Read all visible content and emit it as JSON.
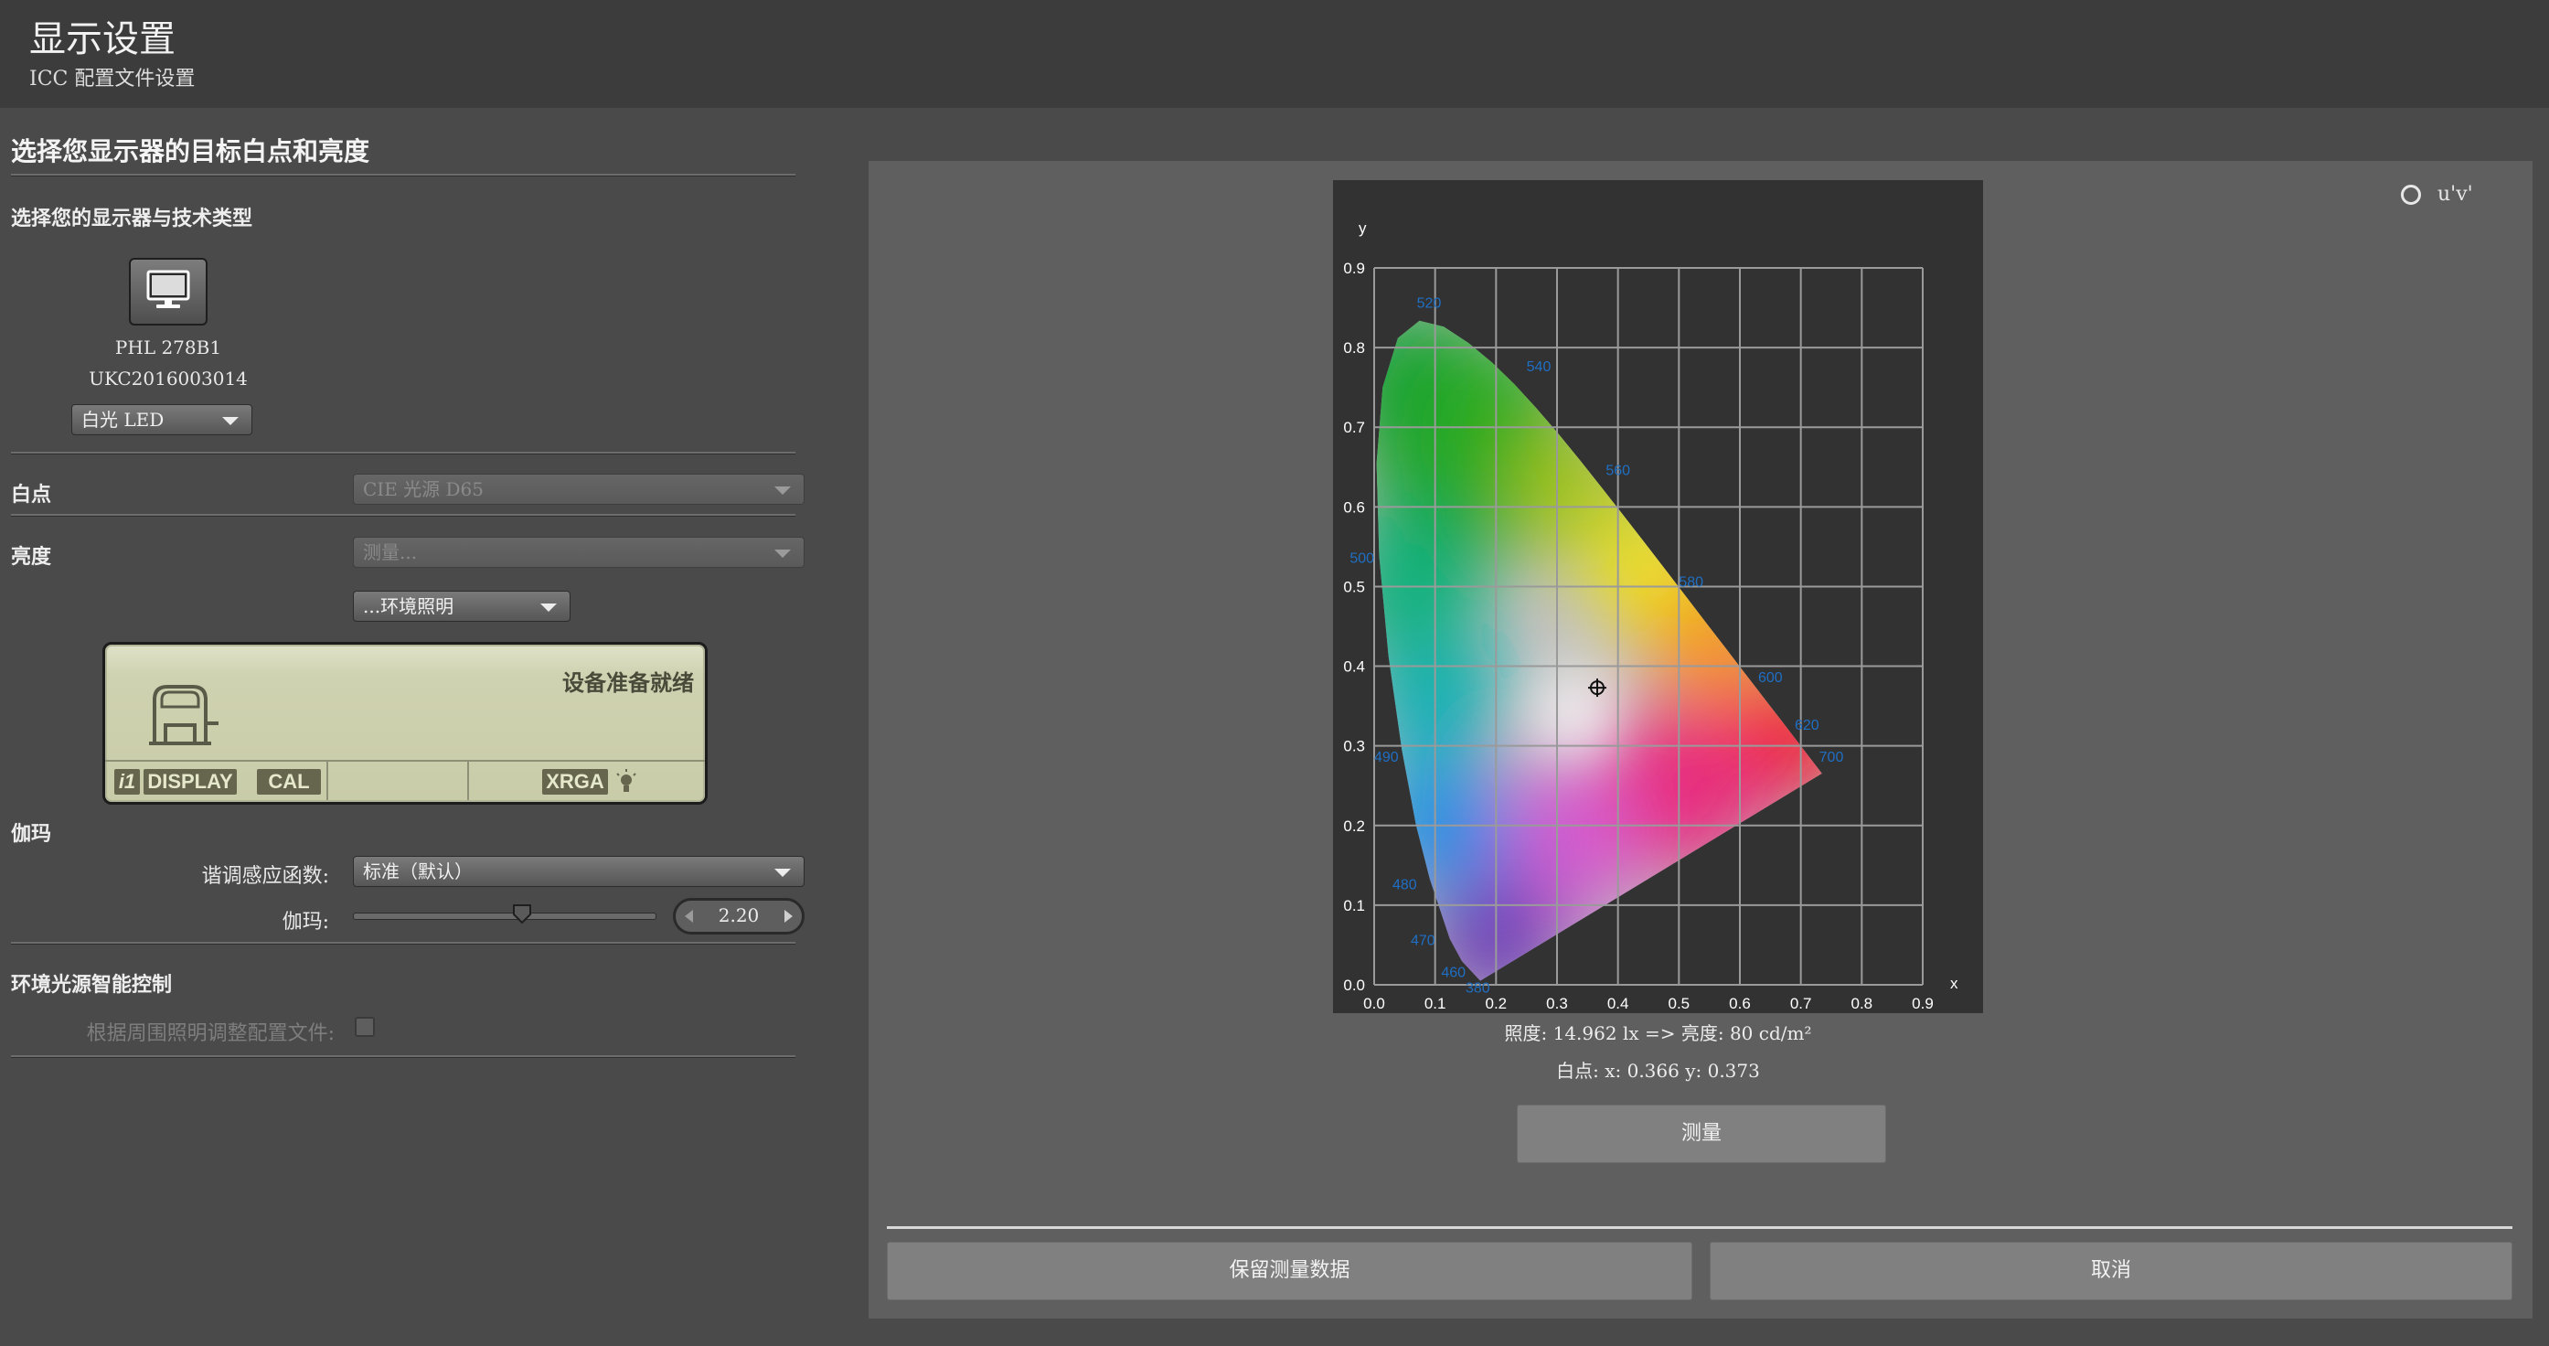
{
  "header": {
    "title": "显示设置",
    "subtitle": "ICC 配置文件设置"
  },
  "left": {
    "main_heading": "选择您显示器的目标白点和亮度",
    "display_section": {
      "heading": "选择您的显示器与技术类型",
      "monitor_name": "PHL 278B1",
      "monitor_serial": "UKC2016003014",
      "technology_value": "白光 LED"
    },
    "whitepoint": {
      "label": "白点",
      "value": "CIE 光源 D65"
    },
    "luminance": {
      "label": "亮度",
      "value": "测量...",
      "ambient_button": "...环境照明"
    },
    "device_panel": {
      "status": "设备准备就绪",
      "tags": {
        "i1": "i1",
        "display": "DISPLAY",
        "cal": "CAL",
        "xrga": "XRGA"
      }
    },
    "gamma": {
      "label": "伽玛",
      "trc_label": "谐调感应函数:",
      "trc_value": "标准（默认）",
      "gamma_label": "伽玛:",
      "gamma_value": "2.20",
      "gamma_fraction": 0.56
    },
    "ambient": {
      "heading": "环境光源智能控制",
      "checkbox_label": "根据周围照明调整配置文件:",
      "checked": false
    }
  },
  "right": {
    "uv_radio_label": "u'v'",
    "illuminance_text": "照度: 14.962 lx => 亮度: 80 cd/m²",
    "whitepoint_text": "白点:  x: 0.366  y: 0.373",
    "measure_button": "测量",
    "keep_button": "保留测量数据",
    "cancel_button": "取消"
  },
  "chart_data": {
    "type": "scatter",
    "title": "",
    "xlabel": "x",
    "ylabel": "y",
    "xlim": [
      0,
      0.9
    ],
    "ylim": [
      0,
      0.9
    ],
    "xticks": [
      "0.0",
      "0.1",
      "0.2",
      "0.3",
      "0.4",
      "0.5",
      "0.6",
      "0.7",
      "0.8",
      "0.9"
    ],
    "yticks": [
      "0.0",
      "0.1",
      "0.2",
      "0.3",
      "0.4",
      "0.5",
      "0.6",
      "0.7",
      "0.8",
      "0.9"
    ],
    "grid": true,
    "wavelength_labels": [
      {
        "label": "520",
        "x": 0.07,
        "y": 0.85
      },
      {
        "label": "540",
        "x": 0.25,
        "y": 0.77
      },
      {
        "label": "560",
        "x": 0.38,
        "y": 0.64
      },
      {
        "label": "580",
        "x": 0.5,
        "y": 0.5
      },
      {
        "label": "600",
        "x": 0.63,
        "y": 0.38
      },
      {
        "label": "620",
        "x": 0.69,
        "y": 0.32
      },
      {
        "label": "700",
        "x": 0.73,
        "y": 0.28
      },
      {
        "label": "500",
        "x": -0.04,
        "y": 0.53
      },
      {
        "label": "490",
        "x": -0.0,
        "y": 0.28
      },
      {
        "label": "480",
        "x": 0.03,
        "y": 0.12
      },
      {
        "label": "470",
        "x": 0.06,
        "y": 0.05
      },
      {
        "label": "460",
        "x": 0.11,
        "y": 0.01
      },
      {
        "label": "380",
        "x": 0.15,
        "y": -0.01
      }
    ],
    "locus": [
      [
        0.1741,
        0.005
      ],
      [
        0.144,
        0.0297
      ],
      [
        0.1241,
        0.0578
      ],
      [
        0.0913,
        0.1327
      ],
      [
        0.0687,
        0.2007
      ],
      [
        0.0454,
        0.295
      ],
      [
        0.0235,
        0.4127
      ],
      [
        0.0082,
        0.5384
      ],
      [
        0.0039,
        0.6548
      ],
      [
        0.0139,
        0.7502
      ],
      [
        0.0389,
        0.812
      ],
      [
        0.0743,
        0.8338
      ],
      [
        0.1142,
        0.8262
      ],
      [
        0.1547,
        0.8059
      ],
      [
        0.1929,
        0.7816
      ],
      [
        0.2296,
        0.7543
      ],
      [
        0.2658,
        0.7243
      ],
      [
        0.3016,
        0.6923
      ],
      [
        0.3373,
        0.6589
      ],
      [
        0.3731,
        0.6245
      ],
      [
        0.4087,
        0.5896
      ],
      [
        0.4441,
        0.5547
      ],
      [
        0.4788,
        0.5202
      ],
      [
        0.5125,
        0.4866
      ],
      [
        0.5448,
        0.4544
      ],
      [
        0.5752,
        0.4242
      ],
      [
        0.6029,
        0.3965
      ],
      [
        0.627,
        0.3725
      ],
      [
        0.6482,
        0.3514
      ],
      [
        0.6658,
        0.334
      ],
      [
        0.6915,
        0.3083
      ],
      [
        0.7347,
        0.2653
      ]
    ],
    "whitepoint": {
      "x": 0.366,
      "y": 0.373
    }
  }
}
